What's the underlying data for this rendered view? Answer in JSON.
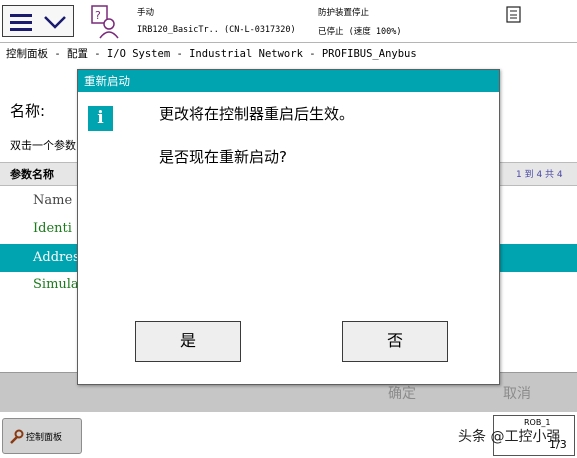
{
  "status": {
    "mode": "手动",
    "controller": "IRB120_BasicTr..  (CN-L-0317320)",
    "safety": "防护装置停止",
    "state": "已停止 (速度 100%)"
  },
  "breadcrumb": "控制面板 - 配置 - I/O System - Industrial Network - PROFIBUS_Anybus",
  "page": {
    "name_label": "名称:",
    "hint": "双击一个参数",
    "table_header": "参数名称",
    "pager": "1 到 4 共 4",
    "rows": [
      "Name",
      "Identi",
      "Addres",
      "Simula"
    ],
    "ok": "确定",
    "cancel": "取消"
  },
  "taskbar": {
    "item_label": "控制面板",
    "rob_label": "ROB_1",
    "rob_value": "1/3"
  },
  "dialog": {
    "title": "重新启动",
    "message_line1": "更改将在控制器重启后生效。",
    "message_line2": "是否现在重新启动?",
    "yes": "是",
    "no": "否"
  },
  "watermark": "头条 @工控小强",
  "colors": {
    "accent": "#00a3b0",
    "green_text": "#1b7a1b"
  }
}
